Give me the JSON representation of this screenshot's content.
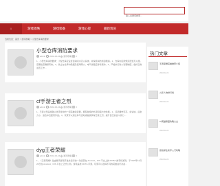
{
  "search": {
    "placeholder": "输入关键词搜索..."
  },
  "nav": {
    "items": [
      {
        "label": "游戏攻略"
      },
      {
        "label": "游戏装备"
      },
      {
        "label": "游戏心得"
      },
      {
        "label": "最新资讯"
      }
    ]
  },
  "breadcrumb": "当前位置：首页 > 游戏攻略 > 小型仓库消防要求",
  "articles": [
    {
      "title": "小型仓库消防要求",
      "author": "admin",
      "date": "2022-02-24",
      "category": "游戏攻略",
      "comments": "0",
      "excerpt": "1、小型仓库消防要求：小型仓库应设置自动喷水灭火系统，并保持消防通道畅通。2、仓库内应按规定配置灭火器，定期检查确保有效。3、禁止在仓库内吸烟及使用明火，电气线路应穿管保护。4、严格执行防火管理制度，做好日常巡查工作…"
    },
    {
      "title": "cf手游王者之烈",
      "author": "admin",
      "date": "2022-02-24",
      "category": "游戏攻略",
      "comments": "0",
      "excerpt": "1、王者之烈是穿越火线手游中的一把英雄级武器，拥有独特的外观和强大的性能。2、该武器伤害高、射速快、后坐力小，适合中近距离作战。3、玩家可以通过参与活动或抽奖获得王者之烈，提升自己的战斗实力…"
    },
    {
      "title": "dyg王者荣耀",
      "author": "admin",
      "date": "2022-02-24",
      "category": "游戏攻略",
      "comments": "0",
      "excerpt": "1、《王者荣耀》是由腾讯游戏开发并运行的一款运营在 Android、IOS 平台上的 MOBA 类手机游戏，于2015年11月26日在 Android、IOS 平台上正式公测。游戏是类 DOTA 手游，玩家可以选择不同的英雄进行对战…"
    }
  ],
  "sidebar": {
    "title": "热门文章",
    "items": [
      {
        "text": "王者荣耀英雄推荐介绍",
        "date": "2022-02-24"
      },
      {
        "text": "火影人物排行榜",
        "date": "2022-02-24"
      },
      {
        "text": "lol英雄联盟攻略大全",
        "date": "2022-02-24"
      },
      {
        "text": "绝地求生新手入门攻略",
        "date": "2022-02-24"
      }
    ]
  }
}
